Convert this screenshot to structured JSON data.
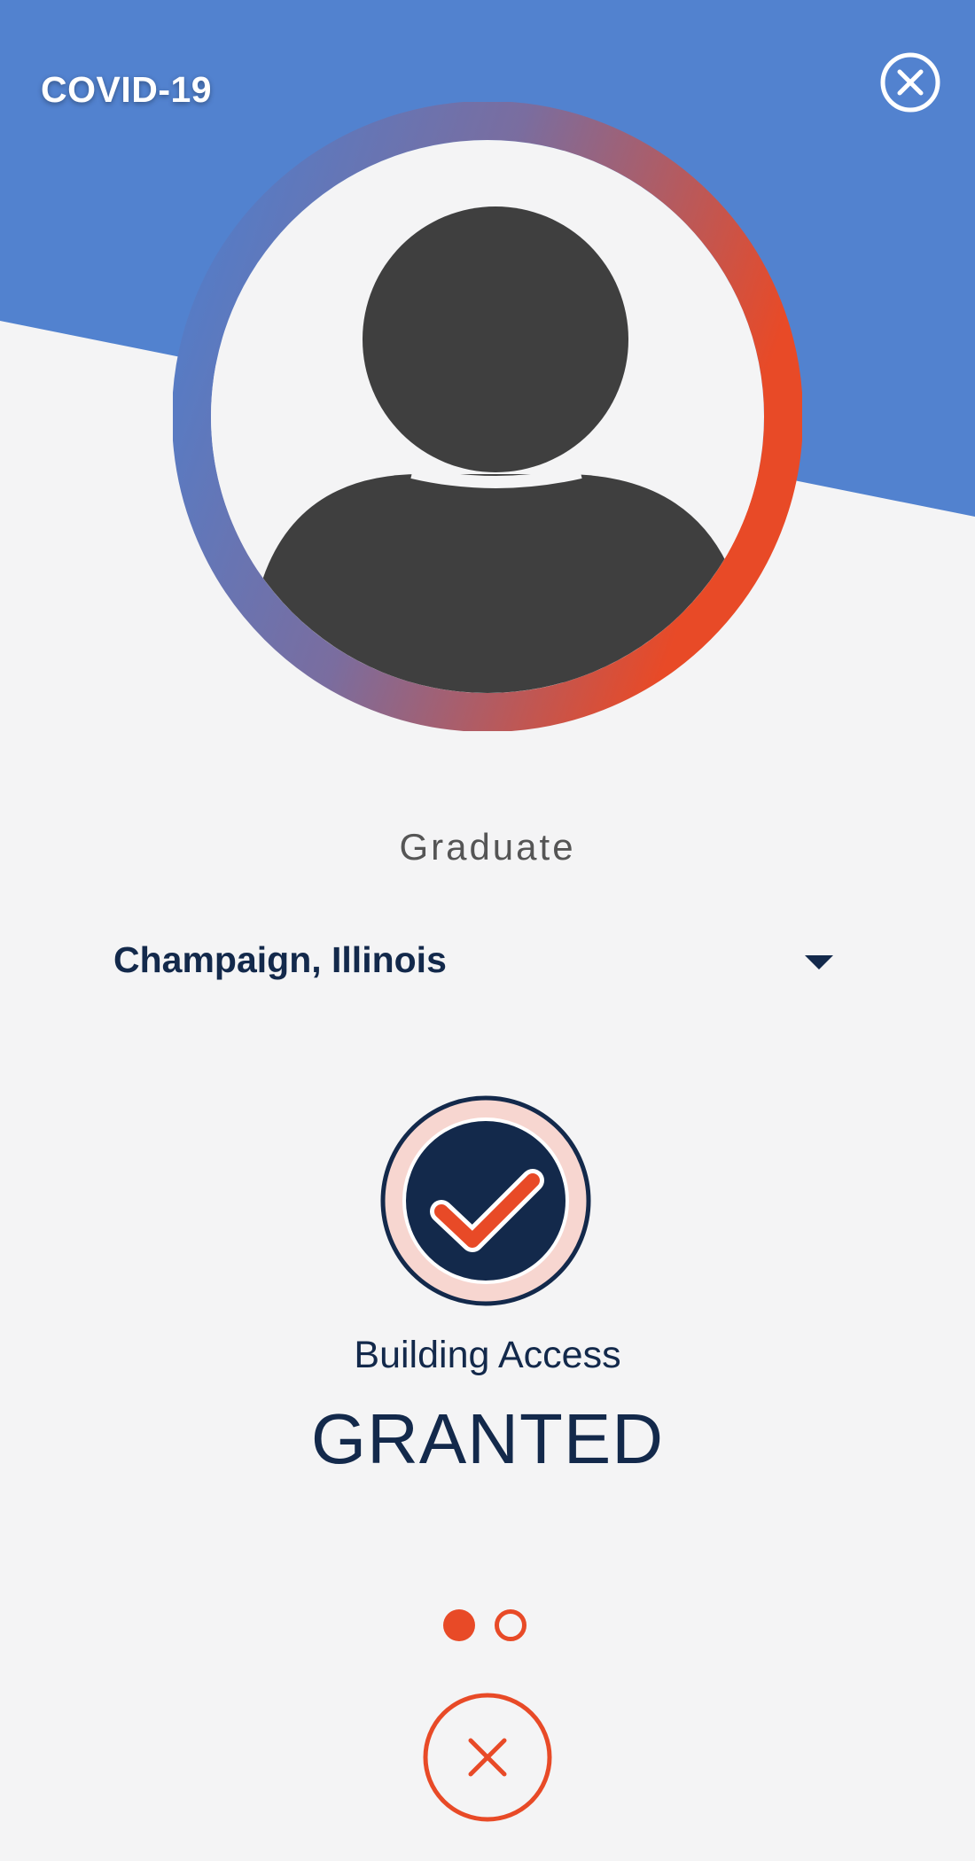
{
  "header": {
    "title": "COVID-19",
    "close_icon": "close-circle-icon"
  },
  "profile": {
    "avatar_icon": "user-silhouette-icon",
    "role": "Graduate"
  },
  "location": {
    "selected": "Champaign, Illinois",
    "caret_icon": "caret-down-icon"
  },
  "status": {
    "icon": "checkmark-badge-icon",
    "caption": "Building Access",
    "value": "GRANTED"
  },
  "pager": {
    "page_count": 2,
    "current_page": 1
  },
  "footer": {
    "close_icon": "close-icon"
  },
  "colors": {
    "header_blue": "#5282cf",
    "accent_orange": "#e84a27",
    "navy": "#13294b",
    "background": "#f4f4f5",
    "silhouette": "#3f3f3f"
  }
}
